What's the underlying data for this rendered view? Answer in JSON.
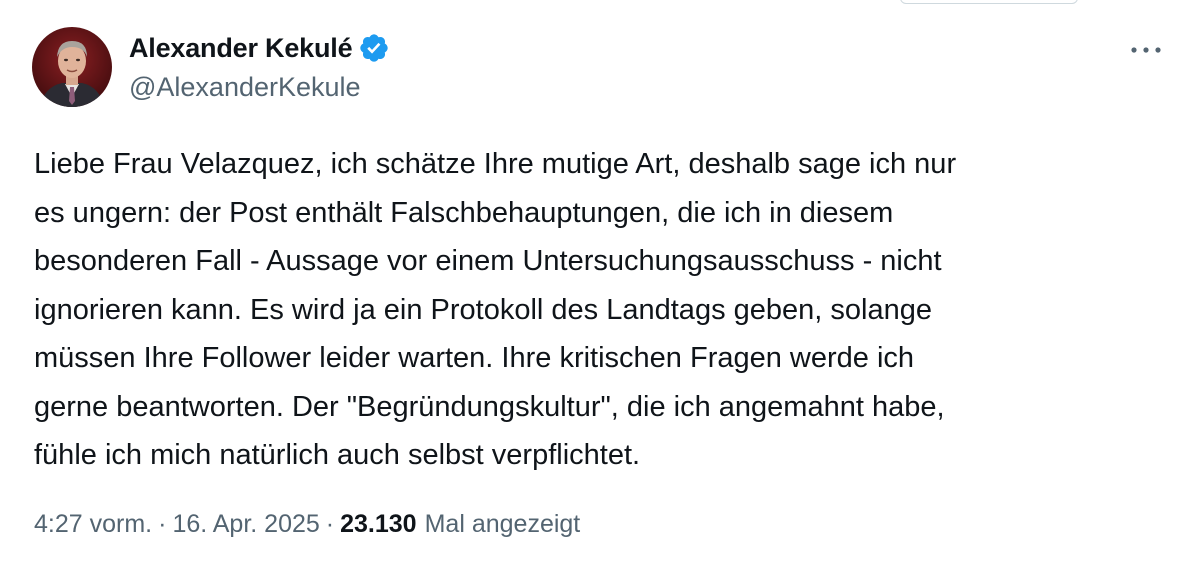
{
  "author": {
    "display_name": "Alexander Kekulé",
    "handle": "@AlexanderKekule",
    "verified": true
  },
  "tweet": {
    "lines": [
      "Liebe Frau Velazquez, ich schätze Ihre mutige Art, deshalb sage ich nur",
      "es ungern: der Post enthält Falschbehauptungen, die ich in diesem",
      "besonderen Fall - Aussage vor einem Untersuchungsausschuss - nicht",
      "ignorieren kann. Es wird ja ein Protokoll des Landtags geben, solange",
      "müssen Ihre Follower leider warten. Ihre kritischen Fragen werde ich",
      "gerne beantworten. Der \"Begründungskultur\", die ich angemahnt habe,",
      "fühle ich mich natürlich auch selbst verpflichtet."
    ]
  },
  "meta": {
    "time": "4:27 vorm.",
    "separator": "·",
    "date": "16. Apr. 2025",
    "views_count": "23.130",
    "views_label": "Mal angezeigt"
  },
  "colors": {
    "text_primary": "#0f1419",
    "text_secondary": "#536471",
    "verified_blue": "#1d9bf0"
  },
  "icons": {
    "verified": "verified-badge-icon",
    "more": "more-dots-icon"
  }
}
